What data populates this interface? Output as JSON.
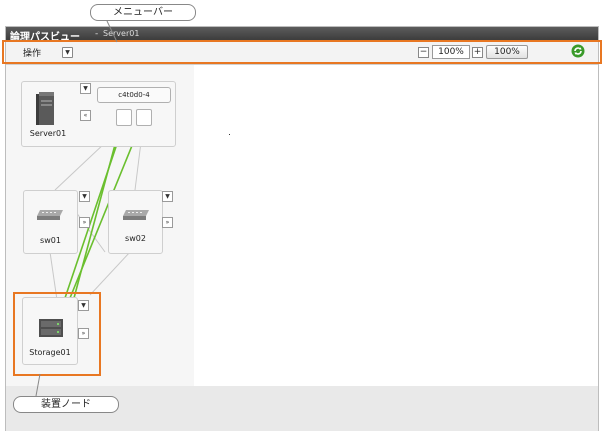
{
  "window": {
    "title": "論理パスビュー",
    "separator": "-",
    "subtitle": "Server01"
  },
  "toolbar": {
    "menu_label": "操作",
    "zoom_value": "100%",
    "zoom_reset_label": "100%"
  },
  "nodes": {
    "server": {
      "label": "Server01",
      "port_label": "c4t0d0-4"
    },
    "sw01": {
      "label": "sw01"
    },
    "sw02": {
      "label": "sw02"
    },
    "storage": {
      "label": "Storage01"
    }
  },
  "callouts": {
    "menu_bar": "メニューバー",
    "device_node": "装置ノード"
  },
  "colors": {
    "callout": "#e87722",
    "active_path": "#6abf2e",
    "inactive_path": "#c8c8c8",
    "title_bar": "#4a4a4a",
    "refresh_icon": "#3a9a2a"
  }
}
